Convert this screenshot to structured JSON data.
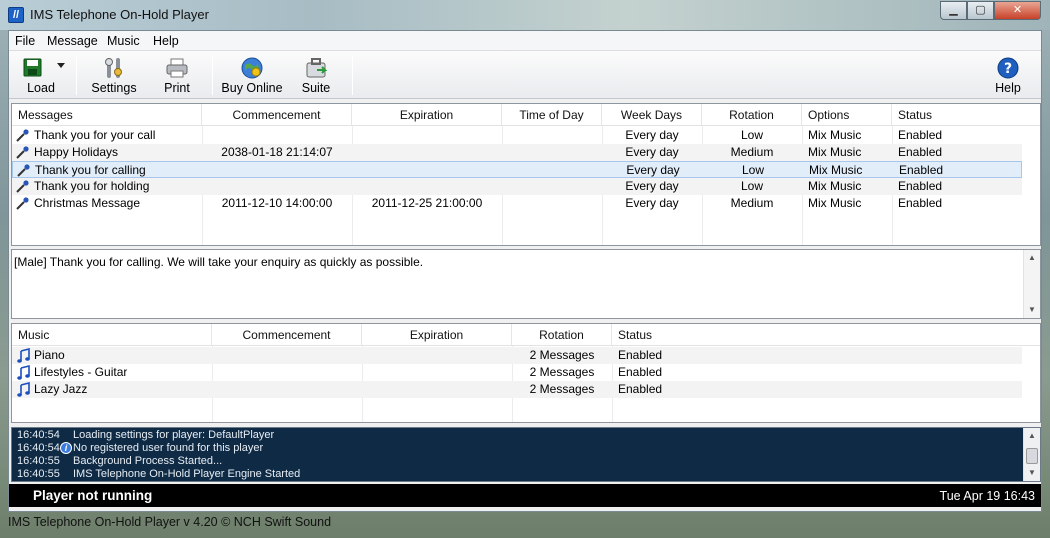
{
  "window": {
    "title": "IMS Telephone On-Hold Player",
    "icon_glyph": "//",
    "min_glyph": "▁",
    "max_glyph": "▢",
    "close_glyph": "✕"
  },
  "menu": [
    "File",
    "Message",
    "Music",
    "Help"
  ],
  "toolbar": {
    "load": "Load",
    "settings": "Settings",
    "print": "Print",
    "buy_online": "Buy Online",
    "suite": "Suite",
    "help": "Help"
  },
  "messages": {
    "columns": [
      "Messages",
      "Commencement",
      "Expiration",
      "Time of Day",
      "Week Days",
      "Rotation",
      "Options",
      "Status"
    ],
    "rows": [
      {
        "name": "Thank you for your call",
        "commencement": "",
        "expiration": "",
        "time_of_day": "",
        "week_days": "Every day",
        "rotation": "Low",
        "options": "Mix Music",
        "status": "Enabled"
      },
      {
        "name": "Happy Holidays",
        "commencement": "2038-01-18 21:14:07",
        "expiration": "",
        "time_of_day": "",
        "week_days": "Every day",
        "rotation": "Medium",
        "options": "Mix Music",
        "status": "Enabled"
      },
      {
        "name": "Thank you for calling",
        "commencement": "",
        "expiration": "",
        "time_of_day": "",
        "week_days": "Every day",
        "rotation": "Low",
        "options": "Mix Music",
        "status": "Enabled"
      },
      {
        "name": "Thank you for holding",
        "commencement": "",
        "expiration": "",
        "time_of_day": "",
        "week_days": "Every day",
        "rotation": "Low",
        "options": "Mix Music",
        "status": "Enabled"
      },
      {
        "name": "Christmas Message",
        "commencement": "2011-12-10 14:00:00",
        "expiration": "2011-12-25 21:00:00",
        "time_of_day": "",
        "week_days": "Every day",
        "rotation": "Medium",
        "options": "Mix Music",
        "status": "Enabled"
      }
    ]
  },
  "preview": {
    "text": "[Male] Thank you for calling. We will take your enquiry as quickly as possible."
  },
  "music": {
    "columns": [
      "Music",
      "Commencement",
      "Expiration",
      "Rotation",
      "Status"
    ],
    "rows": [
      {
        "name": "Piano",
        "commencement": "",
        "expiration": "",
        "rotation": "2 Messages",
        "status": "Enabled"
      },
      {
        "name": "Lifestyles - Guitar",
        "commencement": "",
        "expiration": "",
        "rotation": "2 Messages",
        "status": "Enabled"
      },
      {
        "name": "Lazy Jazz",
        "commencement": "",
        "expiration": "",
        "rotation": "2 Messages",
        "status": "Enabled"
      }
    ]
  },
  "log": [
    {
      "time": "16:40:54",
      "message": "Loading settings for player: DefaultPlayer"
    },
    {
      "time": "16:40:54",
      "message": "No registered user found for this player"
    },
    {
      "time": "16:40:55",
      "message": "Background Process Started..."
    },
    {
      "time": "16:40:55",
      "message": "IMS Telephone On-Hold Player Engine Started"
    }
  ],
  "status": {
    "text": "Player not running",
    "datetime": "Tue Apr 19 16:43"
  },
  "footer": "IMS Telephone On-Hold Player v 4.20 © NCH Swift Sound",
  "colors": {
    "log_background": "#0f2a45",
    "status_background": "#000000",
    "selection": "#e2edfa"
  },
  "icons": [
    "save-icon",
    "settings-icon",
    "printer-icon",
    "globe-icon",
    "suite-icon",
    "help-icon",
    "microphone-icon",
    "music-note-icon",
    "info-icon"
  ]
}
